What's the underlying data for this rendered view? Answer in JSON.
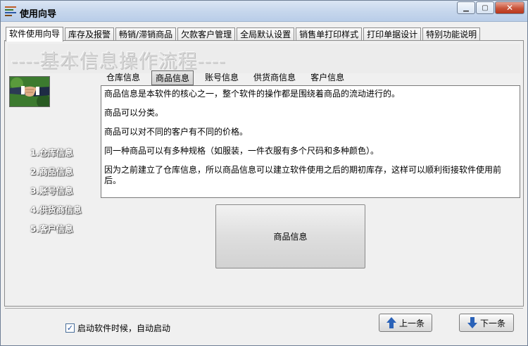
{
  "window": {
    "title": "使用向导",
    "minimize_glyph": "▁",
    "maximize_glyph": "▢",
    "close_glyph": "✕"
  },
  "tabs": [
    {
      "label": "软件使用向导",
      "active": true
    },
    {
      "label": "库存及报警"
    },
    {
      "label": "畅销/滞销商品"
    },
    {
      "label": "欠款客户管理"
    },
    {
      "label": "全局默认设置"
    },
    {
      "label": "销售单打印样式"
    },
    {
      "label": "打印单据设计"
    },
    {
      "label": "特别功能说明"
    }
  ],
  "banner": {
    "title": "----基本信息操作流程----"
  },
  "steps": [
    {
      "label": "1.仓库信息"
    },
    {
      "label": "2.商品信息"
    },
    {
      "label": "3.账号信息"
    },
    {
      "label": "4.供货商信息"
    },
    {
      "label": "5.客户信息"
    }
  ],
  "subtabs": [
    {
      "label": "仓库信息"
    },
    {
      "label": "商品信息",
      "active": true
    },
    {
      "label": "账号信息"
    },
    {
      "label": "供货商信息"
    },
    {
      "label": "客户信息"
    }
  ],
  "info": {
    "paragraphs": [
      "商品信息是本软件的核心之一，整个软件的操作都是围绕着商品的流动进行的。",
      "商品可以分类。",
      "商品可以对不同的客户有不同的价格。",
      "同一种商品可以有多种规格（如服装，一件衣服有多个尺码和多种颜色）。",
      "因为之前建立了仓库信息，所以商品信息可以建立软件使用之后的期初库存，这样可以顺利衔接软件使用前后。"
    ]
  },
  "big_button": {
    "label": "商品信息"
  },
  "footer": {
    "startup_label": "启动软件时候，自动启动",
    "startup_checked": true,
    "check_glyph": "✓",
    "prev_label": "上一条",
    "next_label": "下一条"
  },
  "icons": {
    "app": "app-list-icon",
    "handshake": "handshake-image",
    "prev": "arrow-up-icon",
    "next": "arrow-down-icon"
  }
}
